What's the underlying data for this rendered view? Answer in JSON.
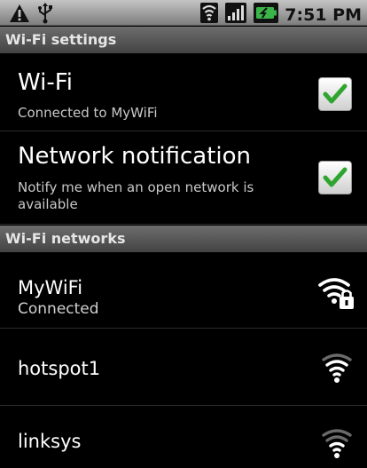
{
  "status_bar": {
    "time": "7:51 PM",
    "left_icons": [
      "warning-icon",
      "usb-icon"
    ],
    "right_icons": [
      "wifi-signal-icon",
      "cell-signal-icon",
      "battery-charging-icon"
    ]
  },
  "header_settings": {
    "title": "Wi-Fi settings"
  },
  "wifi_toggle": {
    "title": "Wi-Fi",
    "subtitle": "Connected to MyWiFi",
    "checked": true
  },
  "network_notification": {
    "title": "Network notification",
    "subtitle": "Notify me when an open network is available",
    "checked": true
  },
  "header_networks": {
    "title": "Wi-Fi networks"
  },
  "networks": [
    {
      "ssid": "MyWiFi",
      "status": "Connected",
      "secured": true,
      "icon": "wifi-lock-icon"
    },
    {
      "ssid": "hotspot1",
      "status": "",
      "secured": false,
      "icon": "wifi-icon"
    },
    {
      "ssid": "linksys",
      "status": "",
      "secured": false,
      "icon": "wifi-icon"
    }
  ],
  "colors": {
    "check_green": "#2fa52f",
    "header_bg": "#555555",
    "status_bar_bg": "#a9a9a9"
  }
}
